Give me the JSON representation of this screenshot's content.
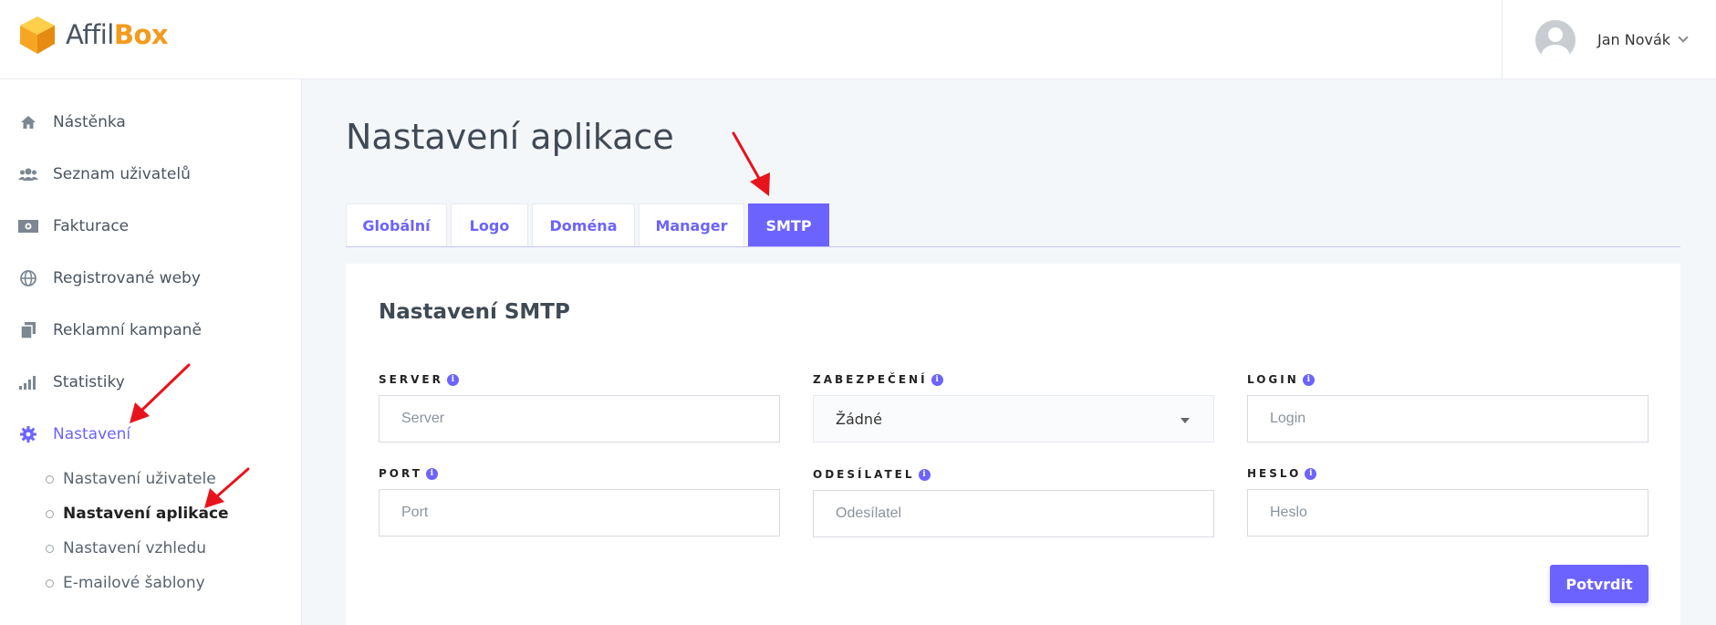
{
  "brand": {
    "name_part1": "Affil",
    "name_part2": "Box",
    "accent_color": "#f29b1d"
  },
  "user": {
    "name": "Jan Novák"
  },
  "sidebar": {
    "items": [
      {
        "label": "Nástěnka",
        "icon": "home-icon"
      },
      {
        "label": "Seznam uživatelů",
        "icon": "users-icon"
      },
      {
        "label": "Fakturace",
        "icon": "money-icon"
      },
      {
        "label": "Registrované weby",
        "icon": "globe-icon"
      },
      {
        "label": "Reklamní kampaně",
        "icon": "copy-icon"
      },
      {
        "label": "Statistiky",
        "icon": "signal-icon"
      },
      {
        "label": "Nastavení",
        "icon": "gear-icon"
      }
    ],
    "subitems": [
      {
        "label": "Nastavení uživatele"
      },
      {
        "label": "Nastavení aplikace"
      },
      {
        "label": "Nastavení vzhledu"
      },
      {
        "label": "E-mailové šablony"
      }
    ]
  },
  "page": {
    "title": "Nastavení aplikace"
  },
  "tabs": [
    {
      "label": "Globální"
    },
    {
      "label": "Logo"
    },
    {
      "label": "Doména"
    },
    {
      "label": "Manager"
    },
    {
      "label": "SMTP"
    }
  ],
  "smtp": {
    "title": "Nastavení SMTP",
    "server_label": "SERVER",
    "server_placeholder": "Server",
    "security_label": "ZABEZPEČENÍ",
    "security_value": "Žádné",
    "login_label": "LOGIN",
    "login_placeholder": "Login",
    "port_label": "PORT",
    "port_placeholder": "Port",
    "sender_label": "ODESÍLATEL",
    "sender_placeholder": "Odesílatel",
    "password_label": "HESLO",
    "password_placeholder": "Heslo",
    "submit_label": "Potvrdit",
    "info_glyph": "i"
  },
  "colors": {
    "primary": "#6c63ff",
    "annotation": "#e8141b"
  }
}
